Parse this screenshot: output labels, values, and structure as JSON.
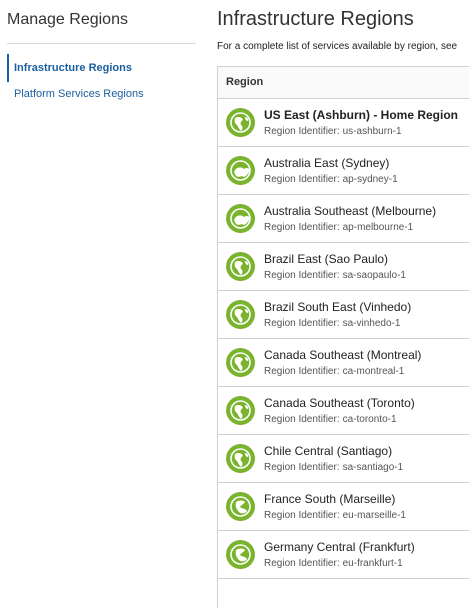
{
  "sidebar": {
    "title": "Manage Regions",
    "items": [
      {
        "label": "Infrastructure Regions",
        "active": true
      },
      {
        "label": "Platform Services Regions",
        "active": false
      }
    ]
  },
  "main": {
    "title": "Infrastructure Regions",
    "intro": "For a complete list of services available by region, see",
    "table": {
      "column_header": "Region",
      "identifier_label": "Region Identifier:",
      "rows": [
        {
          "name": "US East (Ashburn) - Home Region",
          "identifier": "us-ashburn-1",
          "home": true,
          "icon": "globe-americas-icon"
        },
        {
          "name": "Australia East (Sydney)",
          "identifier": "ap-sydney-1",
          "home": false,
          "icon": "globe-asia-icon"
        },
        {
          "name": "Australia Southeast (Melbourne)",
          "identifier": "ap-melbourne-1",
          "home": false,
          "icon": "globe-asia-icon"
        },
        {
          "name": "Brazil East (Sao Paulo)",
          "identifier": "sa-saopaulo-1",
          "home": false,
          "icon": "globe-americas-icon"
        },
        {
          "name": "Brazil South East (Vinhedo)",
          "identifier": "sa-vinhedo-1",
          "home": false,
          "icon": "globe-americas-icon"
        },
        {
          "name": "Canada Southeast (Montreal)",
          "identifier": "ca-montreal-1",
          "home": false,
          "icon": "globe-americas-icon"
        },
        {
          "name": "Canada Southeast (Toronto)",
          "identifier": "ca-toronto-1",
          "home": false,
          "icon": "globe-americas-icon"
        },
        {
          "name": "Chile Central (Santiago)",
          "identifier": "sa-santiago-1",
          "home": false,
          "icon": "globe-americas-icon"
        },
        {
          "name": "France South (Marseille)",
          "identifier": "eu-marseille-1",
          "home": false,
          "icon": "globe-europe-icon"
        },
        {
          "name": "Germany Central (Frankfurt)",
          "identifier": "eu-frankfurt-1",
          "home": false,
          "icon": "globe-europe-icon"
        }
      ]
    }
  },
  "colors": {
    "link": "#1a5f9e",
    "globe_green": "#7ab32e",
    "border": "#cfcfcf"
  }
}
